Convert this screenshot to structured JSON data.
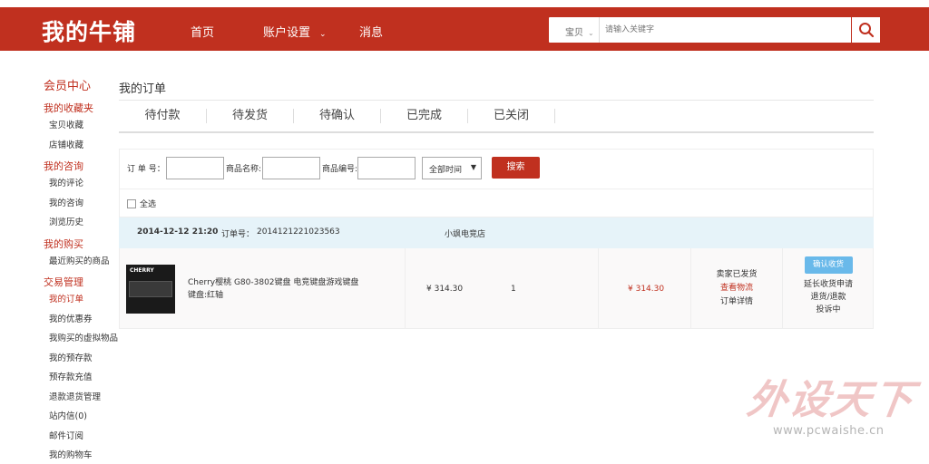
{
  "header": {
    "logo": "我的牛铺",
    "nav": {
      "home": "首页",
      "account": "账户设置",
      "messages": "消息"
    },
    "search": {
      "category": "宝贝",
      "placeholder": "请输入关键字"
    }
  },
  "sidebar": {
    "title": "会员中心",
    "groups": [
      {
        "label": "我的收藏夹",
        "items": [
          "宝贝收藏",
          "店铺收藏"
        ]
      },
      {
        "label": "我的咨询",
        "items": [
          "我的评论",
          "我的咨询",
          "浏览历史"
        ]
      },
      {
        "label": "我的购买",
        "items": [
          "最近购买的商品"
        ]
      },
      {
        "label": "交易管理",
        "items": [
          "我的订单",
          "我的优惠券",
          "我购买的虚拟物品",
          "我的预存款",
          "预存款充值",
          "退款退货管理",
          "站内信(0)",
          "邮件订阅",
          "我的购物车"
        ]
      }
    ],
    "active_item": "我的订单"
  },
  "main": {
    "title": "我的订单",
    "tabs": [
      "待付款",
      "待发货",
      "待确认",
      "已完成",
      "已关闭"
    ],
    "filter": {
      "order_no_label": "订 单 号：",
      "product_name_label": "商品名称:",
      "product_code_label": "商品编号:",
      "time_select": "全部时间",
      "search_button": "搜索"
    },
    "select_all": "全选",
    "order": {
      "date": "2014-12-12 21:20",
      "order_no_label": "订单号：",
      "order_no": "2014121221023563",
      "shop": "小飒电竞店",
      "product_brand": "CHERRY",
      "product_name": "Cherry樱桃 G80-3802键盘 电竞键盘游戏键盘 键盘:红轴",
      "price": "¥ 314.30",
      "quantity": "1",
      "paid": "¥ 314.30",
      "status": "卖家已发货",
      "logistics_link": "查看物流",
      "detail_link": "订单详情",
      "confirm_button": "确认收货",
      "extend_link": "延长收货申请",
      "refund_link": "退货/退款",
      "complaint": "投诉中"
    }
  },
  "watermark": {
    "text": "外设天下",
    "url": "www.pcwaishe.cn"
  },
  "colors": {
    "brand": "#c0301f",
    "header_bg": "#c0301f",
    "order_head_bg": "#e6f3f9",
    "confirm_btn": "#69b9ea"
  }
}
